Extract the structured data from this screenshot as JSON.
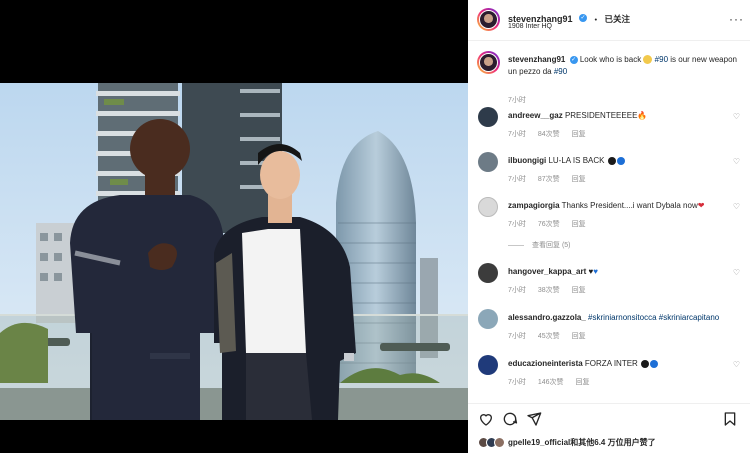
{
  "post": {
    "username": "stevenzhang91",
    "follow_dot": "•",
    "follow_state": "已关注",
    "location": "1908 Inter HQ",
    "more_glyph": "···"
  },
  "caption": {
    "username": "stevenzhang91",
    "text_pre": "Look who is back",
    "hashtag1": "#90",
    "text_mid": "is our new weapon",
    "line2_pre": "un pezzo da",
    "hashtag2": "#90",
    "time": "7小时"
  },
  "comments": [
    {
      "username": "andreew__gaz",
      "text": "PRESIDENTEEEEE",
      "emoji": "🔥",
      "time": "7小时",
      "likes": "84次赞",
      "reply": "回复"
    },
    {
      "username": "ilbuongigi",
      "text": "LU-LA IS BACK",
      "emoji_colors": [
        "#1a1a1a",
        "#1d6fd6"
      ],
      "time": "7小时",
      "likes": "87次赞",
      "reply": "回复"
    },
    {
      "username": "zampagiorgia",
      "text": "Thanks President....i want Dybala now",
      "emoji": "❤",
      "time": "7小时",
      "likes": "76次赞",
      "reply": "回复",
      "replies": "查看回复 (5)"
    },
    {
      "username": "hangover_kappa_art",
      "text": "",
      "emoji_colors": [
        "#1a1a1a",
        "#1d6fd6"
      ],
      "emoji_glyph": "♥",
      "time": "7小时",
      "likes": "38次赞",
      "reply": "回复"
    },
    {
      "username": "alessandro.gazzola_",
      "text": "",
      "tags": "#skriniarnonsitocca #skriniarcapitano",
      "time": "7小时",
      "likes": "45次赞",
      "reply": "回复"
    },
    {
      "username": "educazioneinterista",
      "text": "FORZA INTER",
      "emoji_colors": [
        "#1a1a1a",
        "#1d6fd6"
      ],
      "time": "7小时",
      "likes": "146次赞",
      "reply": "回复"
    }
  ],
  "likes_bar": {
    "liker": "gpelle19_official",
    "suffix": "和其他6.4 万位用户赞了"
  },
  "colors": {
    "link": "#00376b",
    "verified": "#3897f0",
    "meta_gray": "#8e8e8e"
  },
  "icons": [
    "heart-icon",
    "comment-icon",
    "share-icon",
    "bookmark-icon",
    "verified-icon",
    "more-icon"
  ]
}
